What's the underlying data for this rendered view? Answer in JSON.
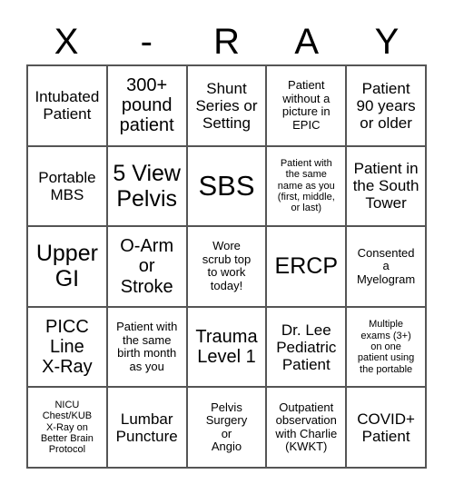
{
  "header": {
    "letters": [
      "X",
      "-",
      "R",
      "A",
      "Y"
    ]
  },
  "grid": {
    "rows": 5,
    "columns": 5,
    "cells": [
      {
        "text": "Intubated\nPatient",
        "size": "md"
      },
      {
        "text": "300+\npound\npatient",
        "size": "lg"
      },
      {
        "text": "Shunt\nSeries or\nSetting",
        "size": "md"
      },
      {
        "text": "Patient\nwithout a\npicture in\nEPIC",
        "size": "sm"
      },
      {
        "text": "Patient\n90 years\nor older",
        "size": "md"
      },
      {
        "text": "Portable\nMBS",
        "size": "md"
      },
      {
        "text": "5 View\nPelvis",
        "size": "xl"
      },
      {
        "text": "SBS",
        "size": "xxl"
      },
      {
        "text": "Patient with\nthe same\nname as you\n(first, middle,\nor last)",
        "size": "xs"
      },
      {
        "text": "Patient in\nthe South\nTower",
        "size": "md"
      },
      {
        "text": "Upper\nGI",
        "size": "xl"
      },
      {
        "text": "O-Arm\nor\nStroke",
        "size": "lg"
      },
      {
        "text": "Wore\nscrub top\nto work\ntoday!",
        "size": "sm"
      },
      {
        "text": "ERCP",
        "size": "xl"
      },
      {
        "text": "Consented\na\nMyelogram",
        "size": "sm"
      },
      {
        "text": "PICC\nLine\nX-Ray",
        "size": "lg"
      },
      {
        "text": "Patient with\nthe same\nbirth month\nas you",
        "size": "sm"
      },
      {
        "text": "Trauma\nLevel 1",
        "size": "lg"
      },
      {
        "text": "Dr. Lee\nPediatric\nPatient",
        "size": "md"
      },
      {
        "text": "Multiple\nexams (3+)\non one\npatient using\nthe portable",
        "size": "xs"
      },
      {
        "text": "NICU\nChest/KUB\nX-Ray on\nBetter Brain\nProtocol",
        "size": "xs"
      },
      {
        "text": "Lumbar\nPuncture",
        "size": "md"
      },
      {
        "text": "Pelvis\nSurgery\nor\nAngio",
        "size": "sm"
      },
      {
        "text": "Outpatient\nobservation\nwith Charlie\n(KWKT)",
        "size": "sm"
      },
      {
        "text": "COVID+\nPatient",
        "size": "md"
      }
    ]
  },
  "colors": {
    "border": "#555555",
    "background": "#ffffff",
    "text": "#000000"
  }
}
